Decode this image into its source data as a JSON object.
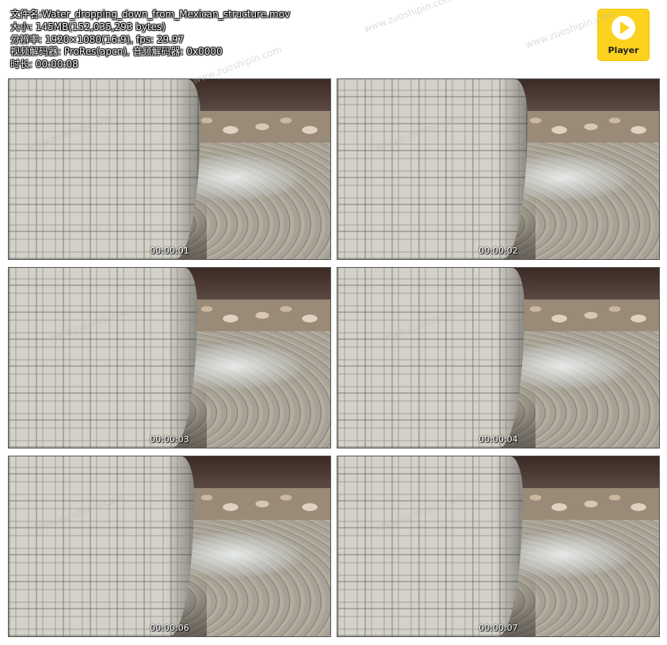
{
  "info": {
    "filename_label": "文件名:",
    "filename": "Water_dropping_down_from_Mexican_structure.mov",
    "size_label": "大小:",
    "size": "145MB(152,035,293 bytes)",
    "resolution_label": "分辨率:",
    "resolution": "1920×1080(16:9), fps: 29.97",
    "codec_label": "视频解码器:",
    "codec": "ProRes(apcn), 音频解码器: 0x0000",
    "duration_label": "时长:",
    "duration": "00:00:08"
  },
  "logo": {
    "label": "Player",
    "icon": "play-icon",
    "color": "#fcd21f"
  },
  "watermark": "www.zuoshipin.com",
  "frames": [
    {
      "timestamp": "00:00:01"
    },
    {
      "timestamp": "00:00:02"
    },
    {
      "timestamp": "00:00:03"
    },
    {
      "timestamp": "00:00:04"
    },
    {
      "timestamp": "00:00:06"
    },
    {
      "timestamp": "00:00:07"
    }
  ]
}
